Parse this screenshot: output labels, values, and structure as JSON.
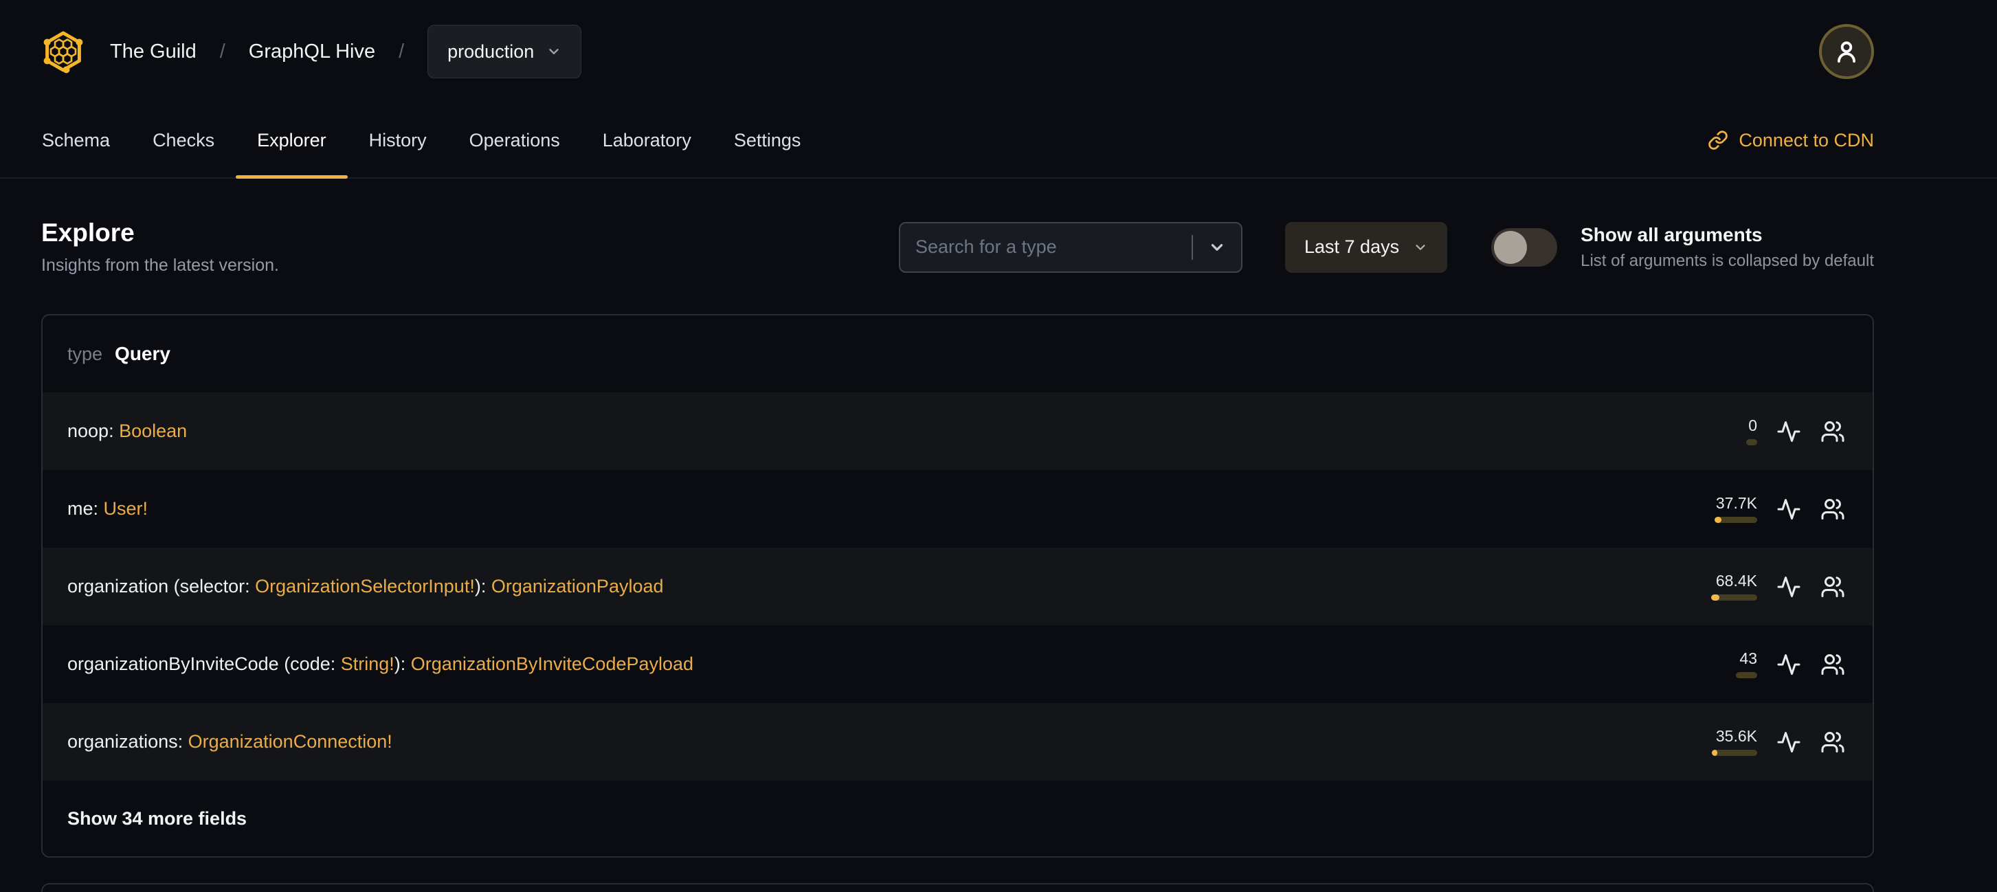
{
  "colors": {
    "bg": "#0a0c11",
    "row_shaded": "#141519",
    "card_border": "#292c30",
    "accent": "#f0b13e",
    "type_color": "#e9ad49",
    "bar_track": "#453e20",
    "bar_fill": "#f2b84a",
    "text_primary": "#eef0f2",
    "text_muted": "#949ca8"
  },
  "header": {
    "breadcrumb": {
      "org": "The Guild",
      "separator": "/",
      "project": "GraphQL Hive",
      "target": "production"
    }
  },
  "tabs": [
    {
      "label": "Schema",
      "active": false
    },
    {
      "label": "Checks",
      "active": false
    },
    {
      "label": "Explorer",
      "active": true
    },
    {
      "label": "History",
      "active": false
    },
    {
      "label": "Operations",
      "active": false
    },
    {
      "label": "Laboratory",
      "active": false
    },
    {
      "label": "Settings",
      "active": false
    }
  ],
  "cdn_link_label": "Connect to CDN",
  "page": {
    "title": "Explore",
    "subtitle": "Insights from the latest version."
  },
  "controls": {
    "search_placeholder": "Search for a type",
    "search_value": "",
    "period": "Last 7 days",
    "toggle_on": false,
    "toggle_label": "Show all arguments",
    "toggle_hint": "List of arguments is collapsed by default"
  },
  "type_card": {
    "kind": "type",
    "name": "Query",
    "fields": [
      {
        "shaded": true,
        "segments": [
          {
            "text": "noop: ",
            "kind": "plain"
          },
          {
            "text": "Boolean",
            "kind": "type"
          }
        ],
        "count": "0",
        "bar": {
          "width": 16,
          "fill": 0
        }
      },
      {
        "shaded": false,
        "segments": [
          {
            "text": "me: ",
            "kind": "plain"
          },
          {
            "text": "User!",
            "kind": "type"
          }
        ],
        "count": "37.7K",
        "bar": {
          "width": 62,
          "fill": 10
        }
      },
      {
        "shaded": true,
        "segments": [
          {
            "text": "organization (selector: ",
            "kind": "plain"
          },
          {
            "text": "OrganizationSelectorInput!",
            "kind": "type"
          },
          {
            "text": "): ",
            "kind": "plain"
          },
          {
            "text": "OrganizationPayload",
            "kind": "type"
          }
        ],
        "count": "68.4K",
        "bar": {
          "width": 67,
          "fill": 12
        }
      },
      {
        "shaded": false,
        "segments": [
          {
            "text": "organizationByInviteCode (code: ",
            "kind": "plain"
          },
          {
            "text": "String!",
            "kind": "type"
          },
          {
            "text": "): ",
            "kind": "plain"
          },
          {
            "text": "OrganizationByInviteCodePayload",
            "kind": "type"
          }
        ],
        "count": "43",
        "bar": {
          "width": 31,
          "fill": 0
        }
      },
      {
        "shaded": true,
        "segments": [
          {
            "text": "organizations: ",
            "kind": "plain"
          },
          {
            "text": "OrganizationConnection!",
            "kind": "type"
          }
        ],
        "count": "35.6K",
        "bar": {
          "width": 66,
          "fill": 8
        }
      }
    ],
    "show_more_label": "Show 34 more fields"
  }
}
